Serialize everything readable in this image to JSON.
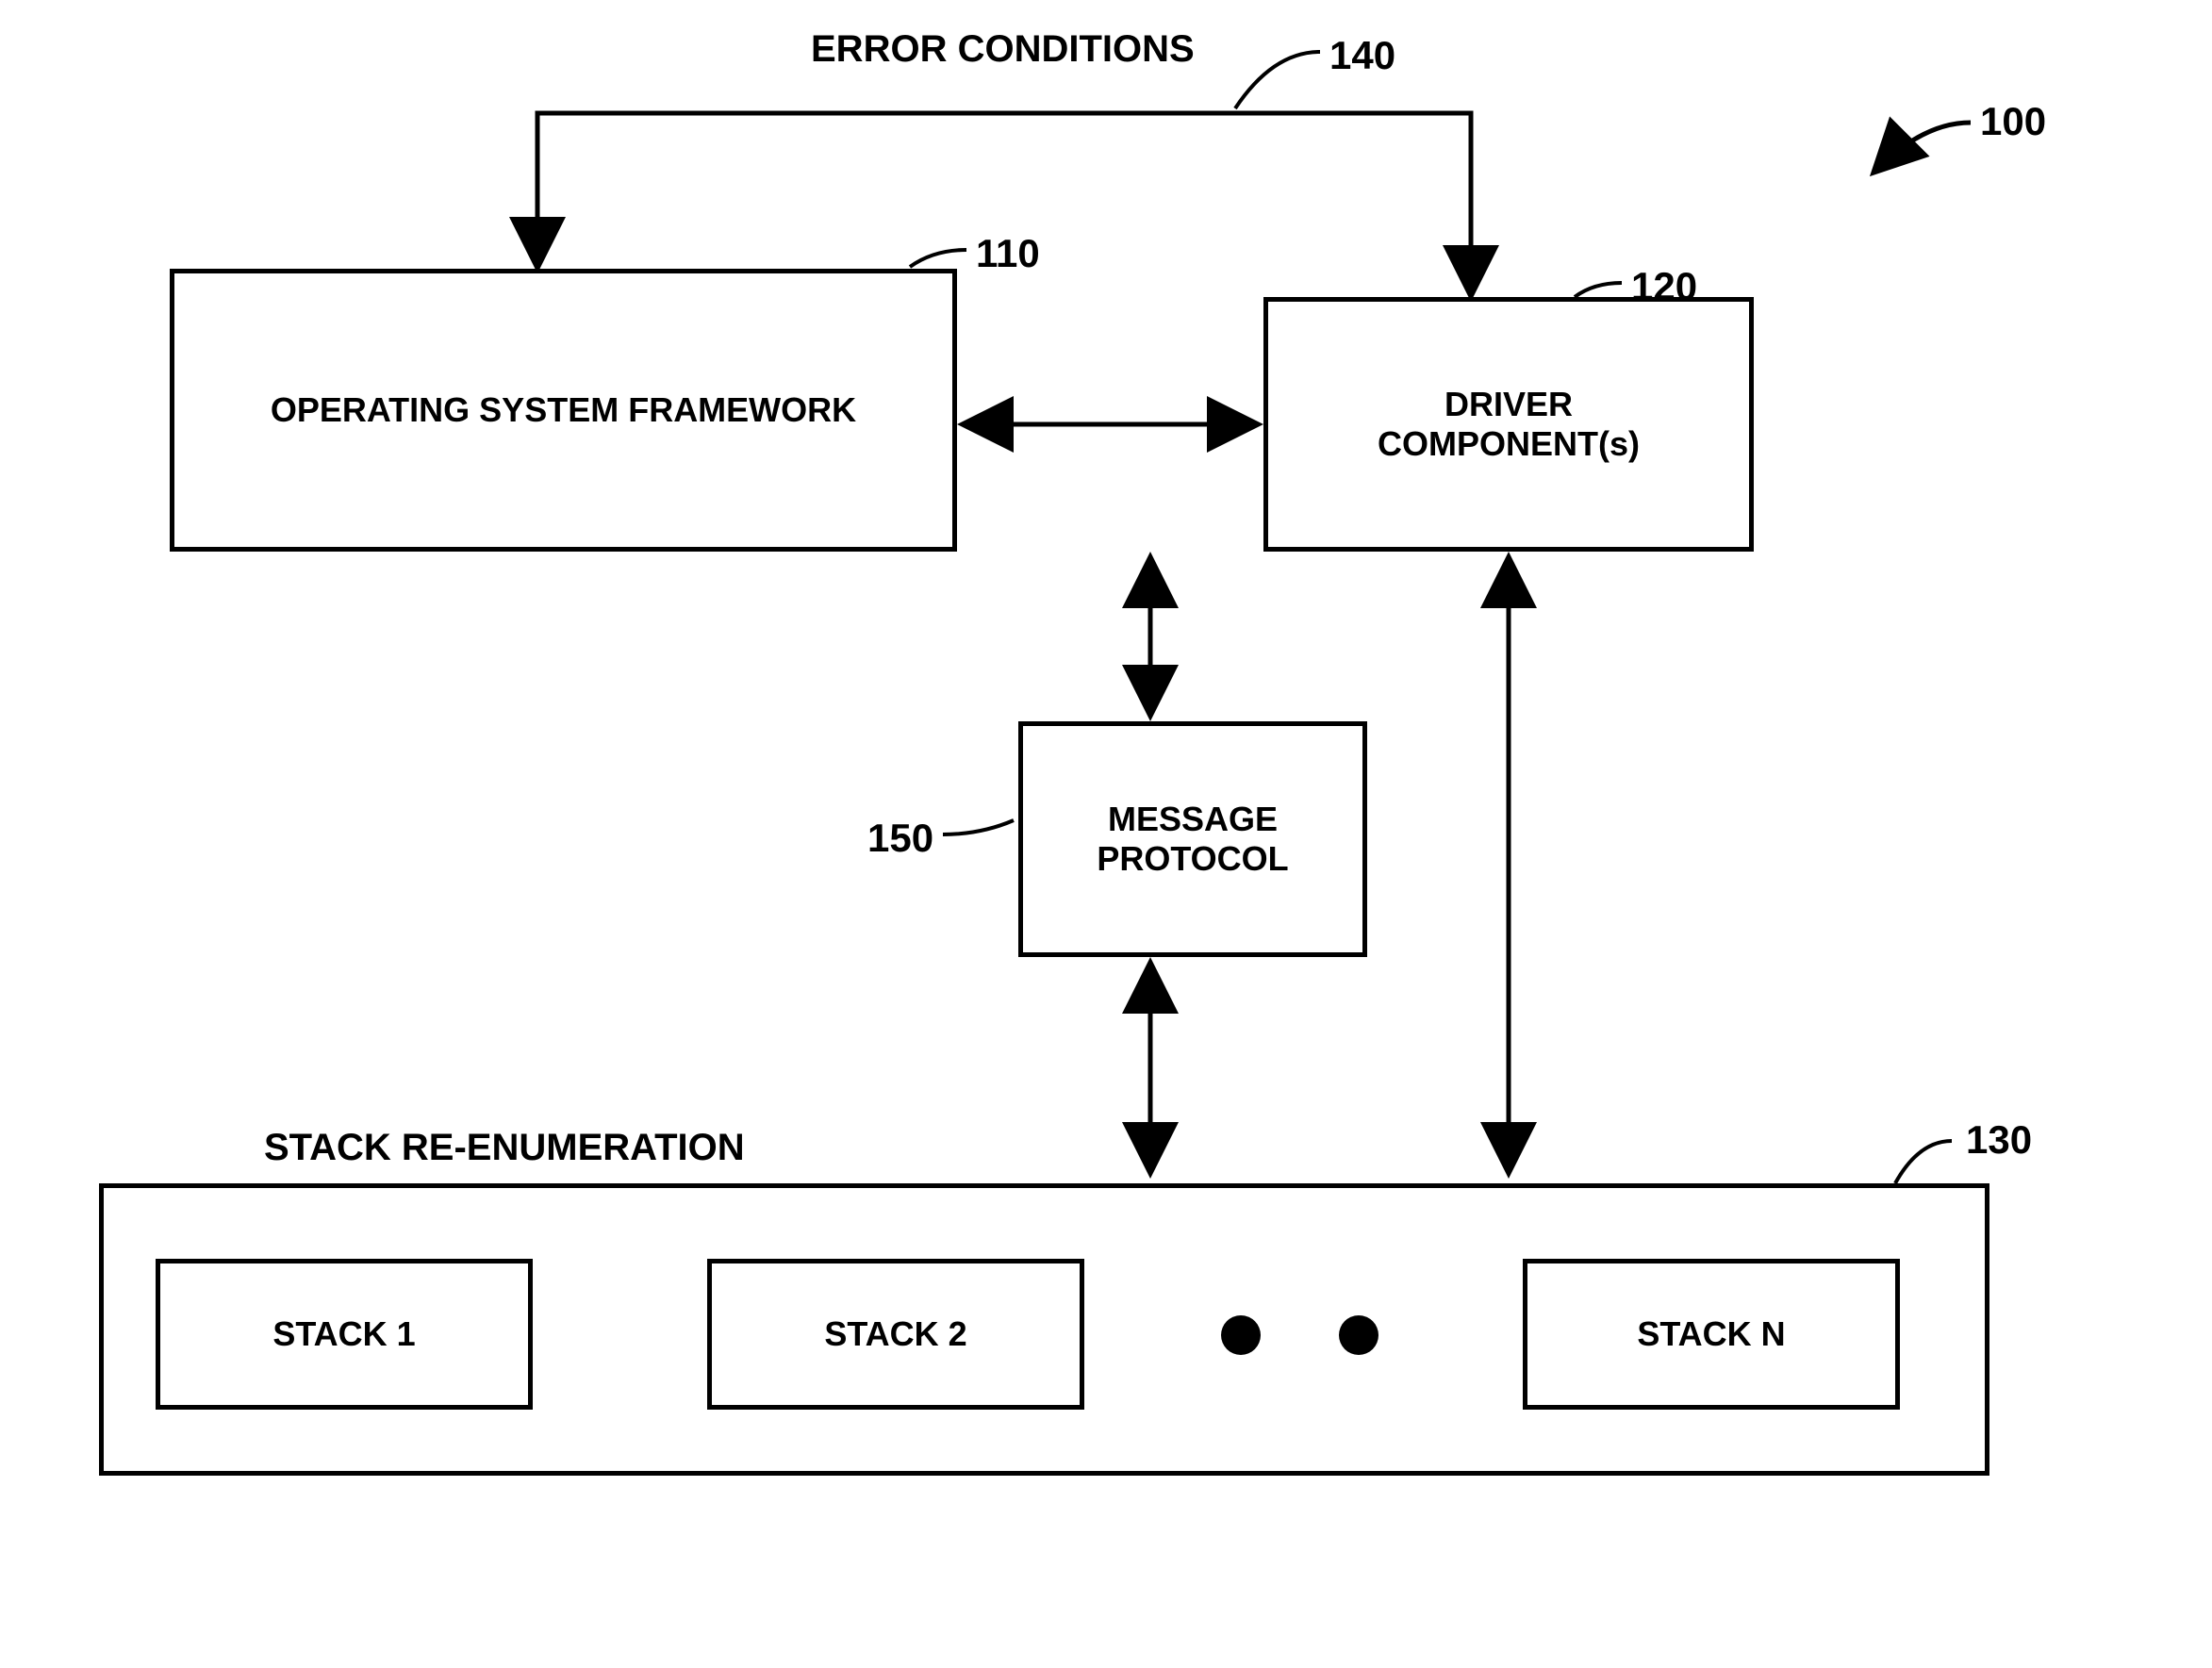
{
  "title_top": "ERROR CONDITIONS",
  "ref_140": "140",
  "ref_100": "100",
  "ref_110": "110",
  "ref_120": "120",
  "ref_150": "150",
  "ref_130": "130",
  "box_os": "OPERATING SYSTEM FRAMEWORK",
  "box_driver_line1": "DRIVER",
  "box_driver_line2": "COMPONENT(s)",
  "box_message_line1": "MESSAGE",
  "box_message_line2": "PROTOCOL",
  "stack_title": "STACK RE-ENUMERATION",
  "stack_1": "STACK 1",
  "stack_2": "STACK 2",
  "stack_n": "STACK N"
}
